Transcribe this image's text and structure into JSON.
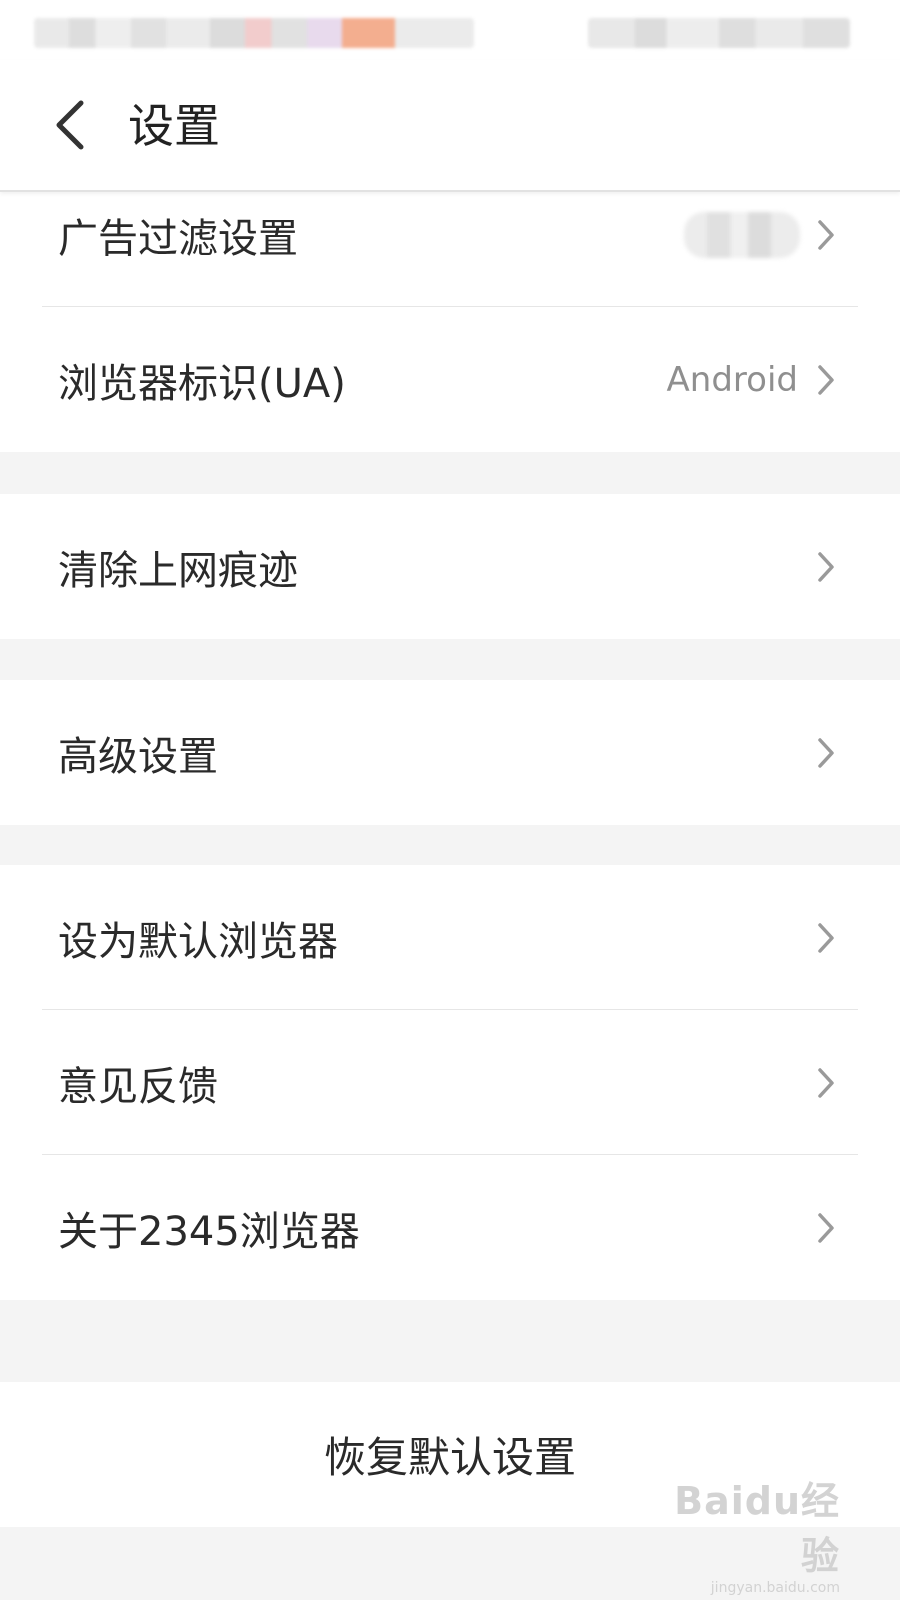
{
  "header": {
    "title": "设置",
    "back_icon": "chevron-left-icon"
  },
  "groups": [
    {
      "items": [
        {
          "label": "广告过滤设置",
          "value": ""
        },
        {
          "label": "浏览器标识(UA)",
          "value": "Android"
        }
      ]
    },
    {
      "items": [
        {
          "label": "清除上网痕迹",
          "value": ""
        }
      ]
    },
    {
      "items": [
        {
          "label": "高级设置",
          "value": ""
        }
      ]
    },
    {
      "items": [
        {
          "label": "设为默认浏览器",
          "value": ""
        },
        {
          "label": "意见反馈",
          "value": ""
        },
        {
          "label": "关于2345浏览器",
          "value": ""
        }
      ]
    }
  ],
  "reset": {
    "label": "恢复默认设置"
  },
  "watermark": {
    "logo": "Baidu经验",
    "url": "jingyan.baidu.com"
  },
  "colors": {
    "background": "#f4f4f4",
    "panel": "#ffffff",
    "text": "#2a2a2a",
    "secondary_text": "#8f8f8f",
    "divider": "#e6e6e6"
  }
}
